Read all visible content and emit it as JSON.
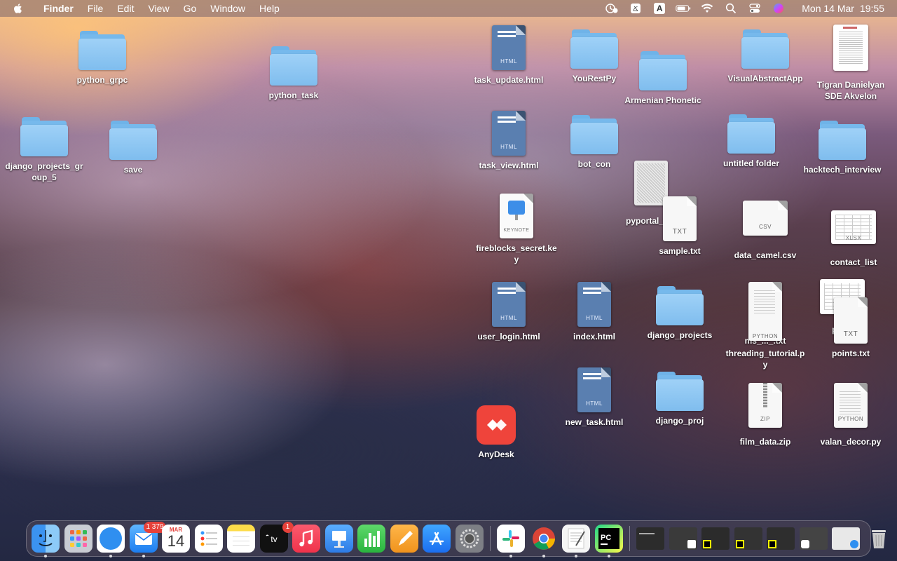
{
  "menubar": {
    "app_name": "Finder",
    "menus": [
      "File",
      "Edit",
      "View",
      "Go",
      "Window",
      "Help"
    ],
    "input_source": "A",
    "clock_date": "Mon 14 Mar",
    "clock_time": "19:55",
    "status_icons": [
      "screen-time-icon",
      "keyboard-layout-icon",
      "input-source-icon",
      "battery-icon",
      "wifi-icon",
      "spotlight-search-icon",
      "control-center-icon",
      "siri-icon"
    ]
  },
  "desktop": {
    "items": [
      {
        "label": "python_grpc",
        "kind": "folder"
      },
      {
        "label": "python_task",
        "kind": "folder"
      },
      {
        "label": "django_projects_group_5",
        "kind": "folder"
      },
      {
        "label": "save",
        "kind": "folder"
      },
      {
        "label": "task_update.html",
        "kind": "html",
        "tag": "HTML"
      },
      {
        "label": "task_view.html",
        "kind": "html",
        "tag": "HTML"
      },
      {
        "label": "fireblocks_secret.key",
        "kind": "keynote",
        "tag": "KEYNOTE"
      },
      {
        "label": "user_login.html",
        "kind": "html",
        "tag": "HTML"
      },
      {
        "label": "AnyDesk",
        "kind": "app"
      },
      {
        "label": "YouRestPy",
        "kind": "folder"
      },
      {
        "label": "bot_con",
        "kind": "folder"
      },
      {
        "label": "index.html",
        "kind": "html",
        "tag": "HTML"
      },
      {
        "label": "new_task.html",
        "kind": "html",
        "tag": "HTML"
      },
      {
        "label": "Armenian Phonetic",
        "kind": "folder"
      },
      {
        "label": "pyportal_log",
        "kind": "file"
      },
      {
        "label": "sample.txt",
        "kind": "txt",
        "tag": "TXT"
      },
      {
        "label": "django_projects",
        "kind": "folder"
      },
      {
        "label": "django_proj",
        "kind": "folder"
      },
      {
        "label": "VisualAbstractApp",
        "kind": "folder"
      },
      {
        "label": "untitled folder",
        "kind": "folder"
      },
      {
        "label": "data_camel.csv",
        "kind": "csv",
        "tag": "CSV"
      },
      {
        "label": "ms_..._.txt",
        "kind": "txt"
      },
      {
        "label": "threading_tutorial.py",
        "kind": "python",
        "tag": "PYTHON"
      },
      {
        "label": "film_data.zip",
        "kind": "zip",
        "tag": "ZIP"
      },
      {
        "label": "Tigran Danielyan SDE Akvelon",
        "kind": "document"
      },
      {
        "label": "hacktech_interview",
        "kind": "folder"
      },
      {
        "label": "contact_list",
        "kind": "xlsx",
        "tag": "XLSX"
      },
      {
        "label": "pay...",
        "kind": "sheet"
      },
      {
        "label": "points.txt",
        "kind": "txt",
        "tag": "TXT"
      },
      {
        "label": "valan_decor.py",
        "kind": "python",
        "tag": "PYTHON"
      }
    ]
  },
  "dock": {
    "mail_badge": "1 379",
    "calendar_month": "MAR",
    "calendar_day": "14",
    "tv_badge": "1",
    "apps": [
      "Finder",
      "Launchpad",
      "Safari",
      "Mail",
      "Calendar",
      "Reminders",
      "Notes",
      "TV",
      "Music",
      "Keynote",
      "Numbers",
      "Pages",
      "App Store",
      "System Preferences",
      "Slack",
      "Chrome",
      "TextEdit",
      "PyCharm",
      "Trash"
    ]
  }
}
